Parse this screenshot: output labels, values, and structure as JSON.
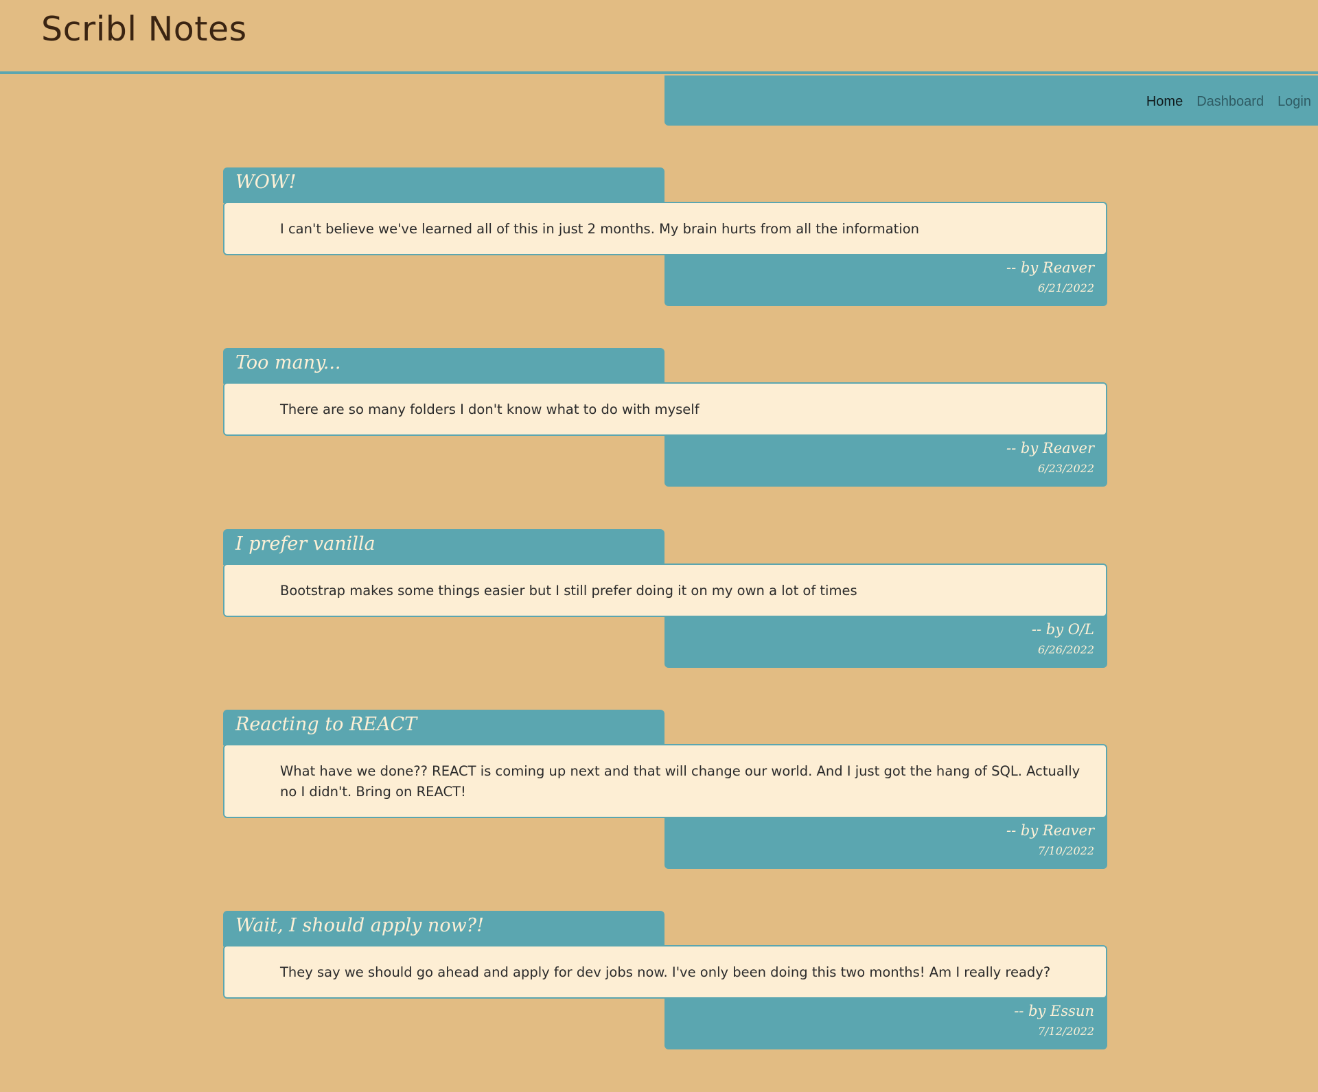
{
  "header": {
    "title": "Scribl Notes"
  },
  "nav": {
    "home": "Home",
    "dashboard": "Dashboard",
    "login": "Login"
  },
  "posts": [
    {
      "title": "WOW!",
      "body": "I can't believe we've learned all of this in just 2 months. My brain hurts from all the information",
      "author": "-- by Reaver",
      "date": "6/21/2022"
    },
    {
      "title": "Too many...",
      "body": "There are so many folders I don't know what to do with myself",
      "author": "-- by Reaver",
      "date": "6/23/2022"
    },
    {
      "title": "I prefer vanilla",
      "body": "Bootstrap makes some things easier but I still prefer doing it on my own a lot of times",
      "author": "-- by O/L",
      "date": "6/26/2022"
    },
    {
      "title": "Reacting to REACT",
      "body": "What have we done?? REACT is coming up next and that will change our world. And I just got the hang of SQL. Actually no I didn't. Bring on REACT!",
      "author": "-- by Reaver",
      "date": "7/10/2022"
    },
    {
      "title": "Wait, I should apply now?!",
      "body": "They say we should go ahead and apply for dev jobs now. I've only been doing this two months! Am I really ready?",
      "author": "-- by Essun",
      "date": "7/12/2022"
    }
  ]
}
